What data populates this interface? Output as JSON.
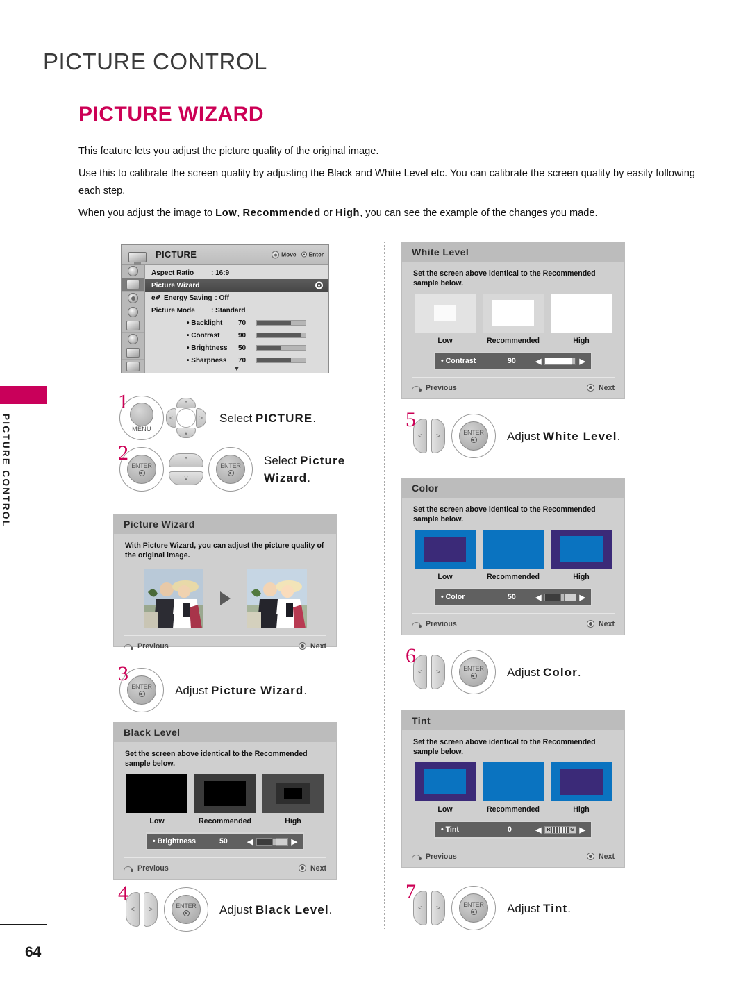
{
  "document": {
    "chapter_title": "PICTURE CONTROL",
    "section_title": "PICTURE WIZARD",
    "page_number": "64",
    "side_tab_label": "PICTURE CONTROL",
    "accent_color": "#cc0055",
    "intro_paragraphs": [
      "This feature lets you adjust the picture quality of the original image.",
      "Use this to calibrate the screen quality by adjusting the Black and White Level etc. You can calibrate the screen quality by easily following each step."
    ],
    "intro_last": {
      "pre": "When you adjust the image to ",
      "b1": "Low",
      "mid1": ", ",
      "b2": "Recommended",
      "mid2": " or ",
      "b3": "High",
      "post": ", you can see the example of the changes you made."
    }
  },
  "osd": {
    "title": "PICTURE",
    "hint_move": "Move",
    "hint_enter": "Enter",
    "rows": [
      {
        "label": "Aspect Ratio",
        "value": ": 16:9"
      },
      {
        "label": "Picture Wizard",
        "value": ""
      },
      {
        "label": "Energy Saving",
        "value": ": Off"
      },
      {
        "label": "Picture Mode",
        "value": ": Standard"
      }
    ],
    "sub_rows": [
      {
        "label": "• Backlight",
        "value": "70",
        "pct": 70
      },
      {
        "label": "• Contrast",
        "value": "90",
        "pct": 90
      },
      {
        "label": "• Brightness",
        "value": "50",
        "pct": 50
      },
      {
        "label": "• Sharpness",
        "value": "70",
        "pct": 70
      }
    ],
    "more_glyph": "▼"
  },
  "steps": {
    "s1": {
      "num": "1",
      "menu_label": "MENU",
      "pre": "Select ",
      "bold": "PICTURE",
      "post": "."
    },
    "s2": {
      "num": "2",
      "enter_label": "ENTER",
      "pre": "Select ",
      "bold": "Picture Wizard",
      "post": "."
    },
    "s3": {
      "num": "3",
      "enter_label": "ENTER",
      "pre": "Adjust ",
      "bold": "Picture Wizard",
      "post": "."
    },
    "s4": {
      "num": "4",
      "enter_label": "ENTER",
      "pre": "Adjust ",
      "bold": "Black Level",
      "post": "."
    },
    "s5": {
      "num": "5",
      "enter_label": "ENTER",
      "pre": "Adjust ",
      "bold": "White Level",
      "post": "."
    },
    "s6": {
      "num": "6",
      "enter_label": "ENTER",
      "pre": "Adjust ",
      "bold": "Color",
      "post": "."
    },
    "s7": {
      "num": "7",
      "enter_label": "ENTER",
      "pre": "Adjust ",
      "bold": "Tint",
      "post": "."
    }
  },
  "common": {
    "set_screen_text": "Set the screen above identical to the Recommended sample below.",
    "previous": "Previous",
    "next": "Next",
    "low": "Low",
    "recommended": "Recommended",
    "high": "High",
    "arrow_left": "◀",
    "arrow_right": "▶"
  },
  "panels": {
    "picture_wizard": {
      "title": "Picture Wizard",
      "desc": "With Picture Wizard, you can adjust the picture quality of the original image."
    },
    "black_level": {
      "title": "Black Level",
      "slider": {
        "name": "• Brightness",
        "value": "50",
        "fill_pct": 50
      },
      "sample_colors": {
        "low_outer": "#000000",
        "low_inner": "#000000",
        "rec_outer": "#3a3a3a",
        "rec_inner": "#000000",
        "high_outer": "#4a4a4a",
        "high_inner": "#000000"
      }
    },
    "white_level": {
      "title": "White Level",
      "slider": {
        "name": "• Contrast",
        "value": "90",
        "fill_pct": 90
      },
      "sample_colors": {
        "low_outer": "#e3e3e3",
        "low_inner": "#fafafa",
        "rec_outer": "#d8d8d8",
        "rec_inner": "#ffffff",
        "high_outer": "#ffffff",
        "high_inner": "#ffffff"
      }
    },
    "color": {
      "title": "Color",
      "slider": {
        "name": "• Color",
        "value": "50",
        "fill_pct": 50
      },
      "sample_colors": {
        "low_outer": "#0a73c0",
        "low_inner": "#3b2a78",
        "rec_outer": "#0a73c0",
        "rec_inner": "#0a73c0",
        "high_outer": "#3b2a78",
        "high_inner": "#0a73c0"
      }
    },
    "tint": {
      "title": "Tint",
      "slider": {
        "name": "• Tint",
        "value": "0",
        "left_mark": "R",
        "right_mark": "G"
      },
      "sample_colors": {
        "low_outer": "#3b2a78",
        "low_inner": "#0a73c0",
        "rec_outer": "#0a73c0",
        "rec_inner": "#0a73c0",
        "high_outer": "#0a73c0",
        "high_inner": "#3b2a78"
      }
    }
  }
}
